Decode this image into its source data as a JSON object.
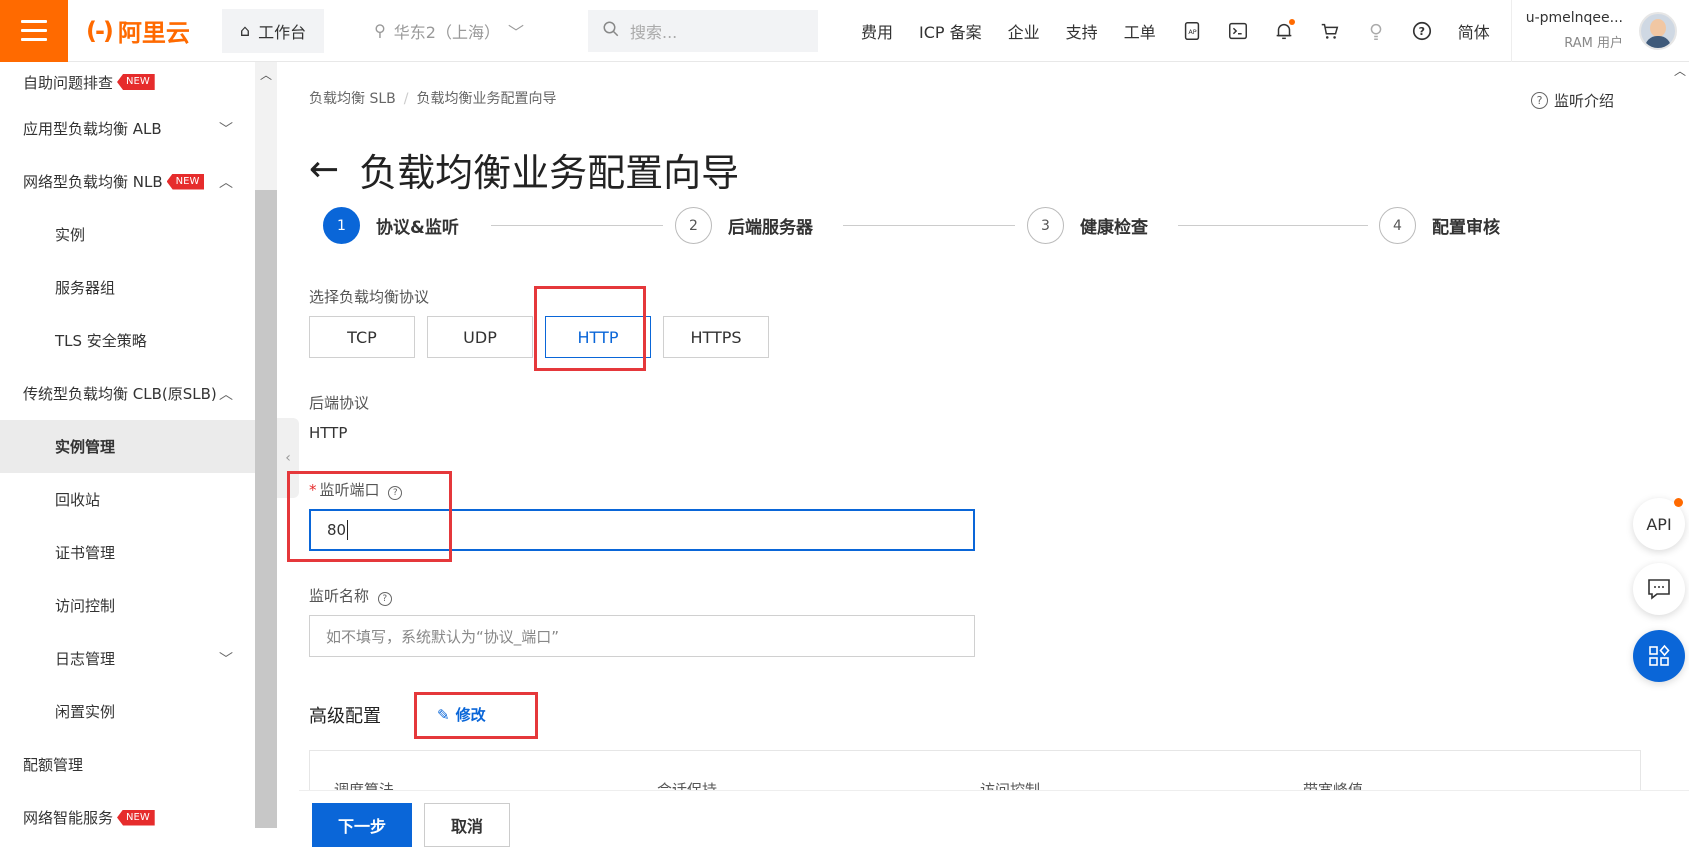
{
  "topbar": {
    "logo_text": "阿里云",
    "logo_mark": "(-)",
    "workbench": "工作台",
    "region": "华东2（上海）",
    "search_placeholder": "搜索...",
    "nav": [
      "费用",
      "ICP 备案",
      "企业",
      "支持",
      "工单"
    ],
    "lang": "简体",
    "user_name": "u-pmelnqee...",
    "user_role": "RAM 用户",
    "accent_color": "#ff6a00"
  },
  "sidebar": {
    "items": [
      {
        "label": "自助问题排查",
        "tag": "NEW",
        "chevron": ""
      },
      {
        "label": "应用型负载均衡 ALB",
        "tag": "",
        "chevron": "﹀"
      },
      {
        "label": "网络型负载均衡 NLB",
        "tag": "NEW",
        "chevron": "︿"
      },
      {
        "label": "实例",
        "tag": "",
        "chevron": ""
      },
      {
        "label": "服务器组",
        "tag": "",
        "chevron": ""
      },
      {
        "label": "TLS 安全策略",
        "tag": "",
        "chevron": ""
      },
      {
        "label": "传统型负载均衡 CLB(原SLB)",
        "tag": "",
        "chevron": "︿"
      },
      {
        "label": "实例管理",
        "tag": "",
        "chevron": ""
      },
      {
        "label": "回收站",
        "tag": "",
        "chevron": ""
      },
      {
        "label": "证书管理",
        "tag": "",
        "chevron": ""
      },
      {
        "label": "访问控制",
        "tag": "",
        "chevron": ""
      },
      {
        "label": "日志管理",
        "tag": "",
        "chevron": "﹀"
      },
      {
        "label": "闲置实例",
        "tag": "",
        "chevron": ""
      },
      {
        "label": "配额管理",
        "tag": "",
        "chevron": ""
      },
      {
        "label": "网络智能服务",
        "tag": "NEW",
        "chevron": ""
      }
    ]
  },
  "main": {
    "breadcrumb": [
      "负载均衡 SLB",
      "负载均衡业务配置向导"
    ],
    "help_link": "监听介绍",
    "title": "负载均衡业务配置向导",
    "steps": [
      {
        "num": "1",
        "label": "协议&监听"
      },
      {
        "num": "2",
        "label": "后端服务器"
      },
      {
        "num": "3",
        "label": "健康检查"
      },
      {
        "num": "4",
        "label": "配置审核"
      }
    ],
    "protocol_label": "选择负载均衡协议",
    "protocols": [
      "TCP",
      "UDP",
      "HTTP",
      "HTTPS"
    ],
    "selected_protocol": "HTTP",
    "backend_label": "后端协议",
    "backend_value": "HTTP",
    "port_label": "监听端口",
    "port_value": "80",
    "name_label": "监听名称",
    "name_placeholder": "如不填写，系统默认为“协议_端口”",
    "advanced_title": "高级配置",
    "edit_label": "修改",
    "advanced_cols": [
      "调度算法",
      "会话保持",
      "访问控制",
      "带宽峰值"
    ],
    "next_button": "下一步",
    "cancel_button": "取消"
  },
  "floating": {
    "api": "API"
  },
  "colors": {
    "primary": "#0a66d8",
    "highlight": "#e5383b"
  }
}
